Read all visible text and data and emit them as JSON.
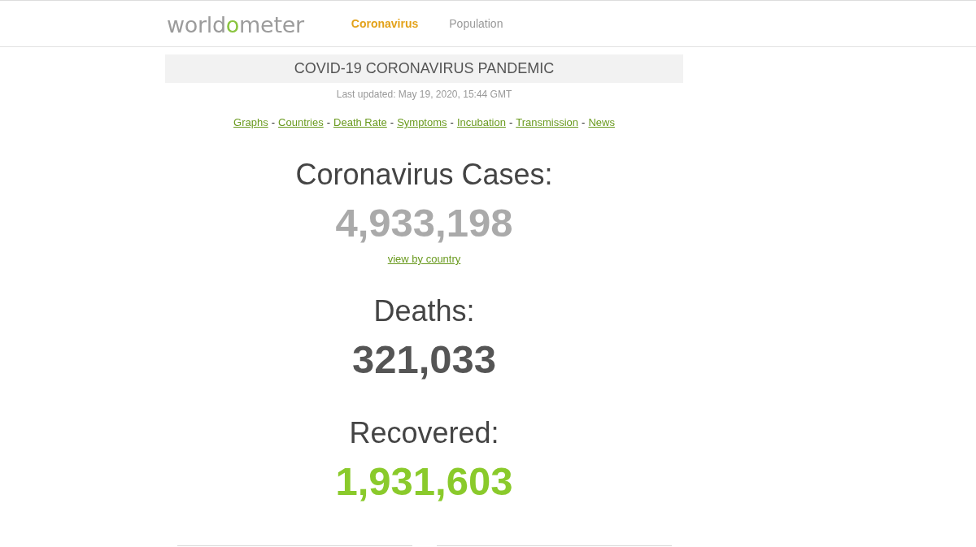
{
  "header": {
    "logo": {
      "before": "world",
      "accent": "o",
      "after": "meter"
    },
    "nav": [
      {
        "label": "Coronavirus",
        "selected": true
      },
      {
        "label": "Population",
        "selected": false
      }
    ]
  },
  "title": "COVID-19 CORONAVIRUS PANDEMIC",
  "last_updated": "Last updated: May 19, 2020, 15:44 GMT",
  "links": [
    {
      "label": "Graphs",
      "separator": "-"
    },
    {
      "label": "Countries",
      "separator": "-"
    },
    {
      "label": "Death Rate",
      "separator": "-"
    },
    {
      "label": "Symptoms",
      "separator": "-"
    },
    {
      "label": "Incubation",
      "separator": "-"
    },
    {
      "label": "Transmission",
      "separator": "-"
    },
    {
      "label": "News"
    }
  ],
  "counters": [
    {
      "label": "Coronavirus Cases:",
      "value": "4,933,198",
      "color": "#aaaaaa",
      "link": "view by country"
    },
    {
      "label": "Deaths:",
      "value": "321,033",
      "color": "#555555"
    },
    {
      "label": "Recovered:",
      "value": "1,931,603",
      "color": "#8aca2b"
    }
  ]
}
